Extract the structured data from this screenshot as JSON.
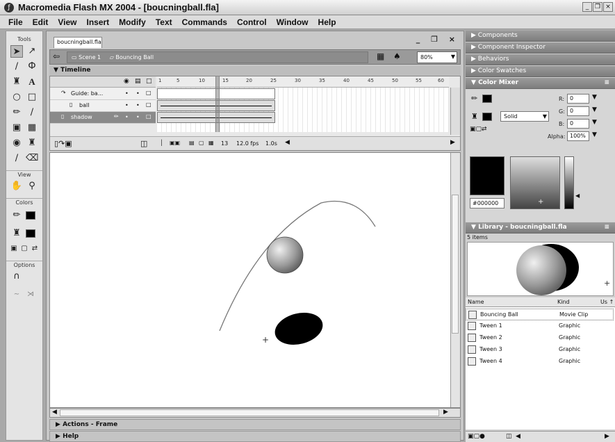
{
  "window": {
    "title": "Macromedia Flash MX 2004 - [boucningball.fla]"
  },
  "menu": [
    "File",
    "Edit",
    "View",
    "Insert",
    "Modify",
    "Text",
    "Commands",
    "Control",
    "Window",
    "Help"
  ],
  "tools": {
    "title": "Tools",
    "view_label": "View",
    "colors_label": "Colors",
    "options_label": "Options"
  },
  "document": {
    "tab": "boucningball.fla",
    "scene": "Scene 1",
    "symbol": "Bouncing Ball",
    "zoom": "80%",
    "timeline_title": "Timeline",
    "layers": [
      {
        "name": "Guide: ba...",
        "selected": false
      },
      {
        "name": "ball",
        "selected": false
      },
      {
        "name": "shadow",
        "selected": true
      }
    ],
    "frame_numbers": [
      "1",
      "5",
      "10",
      "15",
      "20",
      "25",
      "30",
      "35",
      "40",
      "45",
      "50",
      "55",
      "60"
    ],
    "status": {
      "frame": "13",
      "fps": "12.0 fps",
      "time": "1.0s"
    },
    "bottom_panels": [
      "Actions - Frame",
      "Help"
    ]
  },
  "panels": {
    "collapsed": [
      "Components",
      "Component Inspector",
      "Behaviors",
      "Color Swatches"
    ],
    "color_mixer": {
      "title": "Color Mixer",
      "fill_type": "Solid",
      "r_label": "R:",
      "r": "0",
      "g_label": "G:",
      "g": "0",
      "b_label": "B:",
      "b": "0",
      "alpha_label": "Alpha:",
      "alpha": "100%",
      "hex": "#000000"
    },
    "library": {
      "title": "Library - boucningball.fla",
      "count": "5 items",
      "col_name": "Name",
      "col_kind": "Kind",
      "col_use": "Us ↑",
      "items": [
        {
          "name": "Bouncing Ball",
          "kind": "Movie Clip"
        },
        {
          "name": "Tween 1",
          "kind": "Graphic"
        },
        {
          "name": "Tween 2",
          "kind": "Graphic"
        },
        {
          "name": "Tween 3",
          "kind": "Graphic"
        },
        {
          "name": "Tween 4",
          "kind": "Graphic"
        }
      ]
    }
  },
  "colors": {
    "accent": "#7d7d7d",
    "stage": "#ffffff",
    "fill": "#000000"
  }
}
